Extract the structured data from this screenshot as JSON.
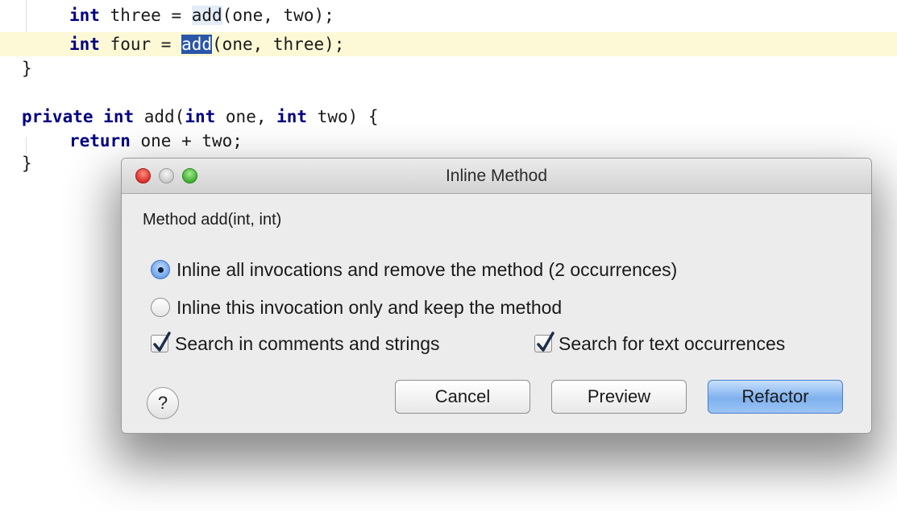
{
  "editor": {
    "line1": {
      "kw": "int",
      "pre": " three = ",
      "call": "add",
      "post": "(one, two);"
    },
    "line2": {
      "kw": "int",
      "pre": " four = ",
      "call": "add",
      "post": "(one, three);"
    },
    "brace_close": "}",
    "line4": {
      "kw1": "private",
      "mid1": " ",
      "kw2": "int",
      "mid2": " add(",
      "kw3": "int",
      "mid3": " one, ",
      "kw4": "int",
      "mid4": " two) {"
    },
    "line5": {
      "kw": "return",
      "rest": " one + two;"
    },
    "brace_close2": "}"
  },
  "dialog": {
    "title": "Inline Method",
    "method_label": "Method add(int, int)",
    "options": {
      "inline_all": {
        "label": "Inline all invocations and remove the method (2 occurrences)",
        "selected": true
      },
      "inline_this": {
        "label": "Inline this invocation only and keep the method",
        "selected": false
      }
    },
    "checks": {
      "search_comments": {
        "label": "Search in comments and strings",
        "checked": true
      },
      "search_text": {
        "label": "Search for text occurrences",
        "checked": true
      }
    },
    "help_label": "?",
    "buttons": {
      "cancel": "Cancel",
      "preview": "Preview",
      "refactor": "Refactor"
    }
  },
  "colors": {
    "keyword": "#000080",
    "current_line": "#fdf8d6",
    "selection": "#2a56a8",
    "primary_button": "#7fb1ee"
  },
  "icons": {
    "radio_selected": "radio-selected-icon",
    "radio_unselected": "radio-unselected-icon",
    "checkbox_checked": "checkmark-icon"
  }
}
